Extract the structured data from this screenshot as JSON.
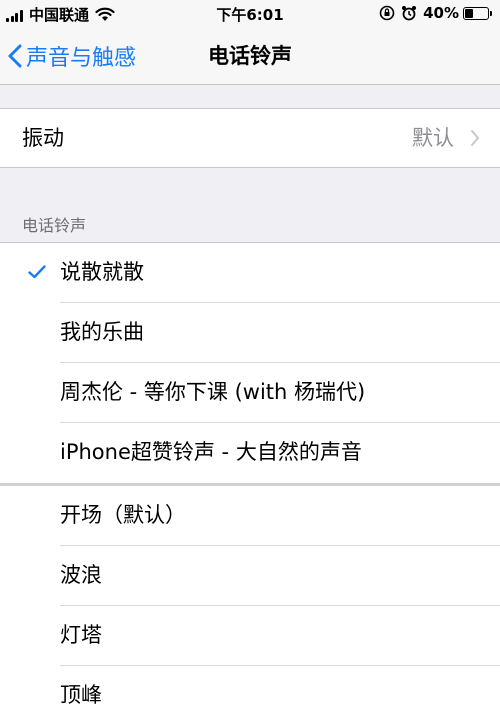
{
  "status_bar": {
    "carrier": "中国联通",
    "time": "下午6:01",
    "battery_percent": "40%",
    "battery_level": 0.4,
    "icons": [
      "signal-icon",
      "wifi-icon",
      "rotation-lock-icon",
      "alarm-icon",
      "battery-icon"
    ]
  },
  "nav": {
    "back_label": "声音与触感",
    "title": "电话铃声"
  },
  "vibration": {
    "label": "振动",
    "value": "默认"
  },
  "section_header": "电话铃声",
  "ringtones_top": [
    {
      "label": "说散就散",
      "selected": true
    },
    {
      "label": "我的乐曲",
      "selected": false
    },
    {
      "label": "周杰伦 - 等你下课 (with 杨瑞代)",
      "selected": false
    },
    {
      "label": "iPhone超赞铃声 - 大自然的声音",
      "selected": false
    }
  ],
  "ringtones_builtin": [
    {
      "label": "开场（默认）"
    },
    {
      "label": "波浪"
    },
    {
      "label": "灯塔"
    },
    {
      "label": "顶峰"
    }
  ],
  "colors": {
    "accent": "#1a7cf4",
    "background": "#efeff4",
    "secondary_text": "#8e8e93"
  }
}
